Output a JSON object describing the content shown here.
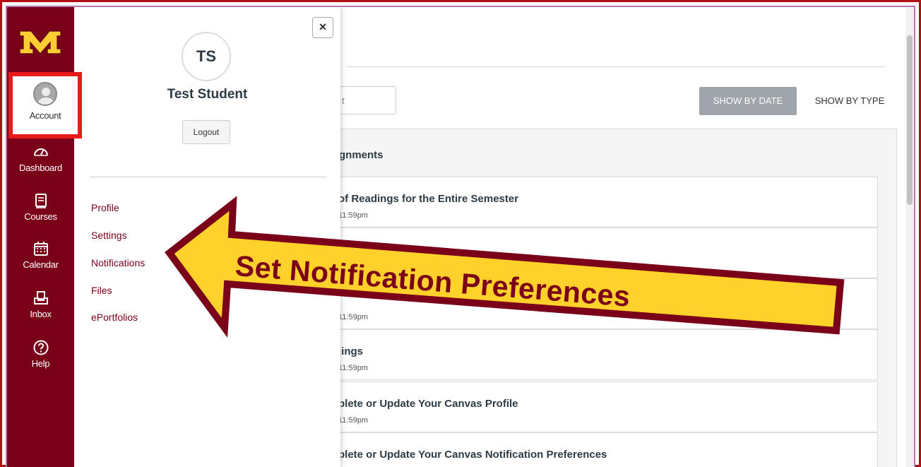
{
  "nav": {
    "account": "Account",
    "dashboard": "Dashboard",
    "courses": "Courses",
    "calendar": "Calendar",
    "inbox": "Inbox",
    "help": "Help"
  },
  "brand": {
    "maroon": "#7a0019",
    "gold": "#ffcc33",
    "highlight": "#e81a1a"
  },
  "tray": {
    "close": "×",
    "initials": "TS",
    "name": "Test Student",
    "logout": "Logout",
    "links": [
      "Profile",
      "Settings",
      "Notifications",
      "Files",
      "ePortfolios"
    ]
  },
  "main": {
    "search_partial": "t",
    "show_by_date": "SHOW BY DATE",
    "show_by_type": "SHOW BY TYPE",
    "section_title": "gnments",
    "items": [
      {
        "title": "of Readings for the Entire Semester",
        "due": "11:59pm"
      },
      {
        "title": "",
        "due": ""
      },
      {
        "title": "",
        "due": "11:59pm"
      },
      {
        "title": "lings",
        "due": "11:59pm"
      },
      {
        "title": "plete or Update Your Canvas Profile",
        "due": "11:59pm"
      },
      {
        "title": "plete or Update Your Canvas Notification Preferences",
        "due": ""
      }
    ]
  },
  "annotation": {
    "text": "Set Notification Preferences"
  }
}
